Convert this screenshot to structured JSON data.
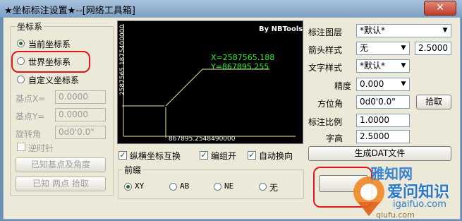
{
  "window": {
    "title": "★坐标标注设置★--[网络工具箱]",
    "close_glyph": "✕"
  },
  "coord_system": {
    "group_label": "坐标系",
    "options": [
      "当前坐标系",
      "世界坐标系",
      "自定义坐标系"
    ],
    "selected": 0,
    "base_x_label": "基点X=",
    "base_x_value": "0.0000",
    "base_y_label": "基点Y=",
    "base_y_value": "0.0000",
    "rotation_label": "旋转角",
    "rotation_value": "0d0'0.0\"",
    "ccw_label": "逆时针",
    "btn_known_base": "已知基点及角度",
    "btn_known_two_points": "已知 两点 拾取"
  },
  "preview": {
    "brand": "By NBTools",
    "x_text": "X=2587565.188",
    "y_text": "Y=867895.255",
    "vertical_axis_text": "2587565.1875400000",
    "horizontal_axis_text": "867895.2548490000",
    "accent_green": "#33ee33",
    "line_color": "#e8e8a0"
  },
  "options_row": {
    "swap_label": "纵横坐标互换",
    "swap_checked": true,
    "group_label": "编组开",
    "group_checked": true,
    "wrap_label": "自动换向",
    "wrap_checked": true
  },
  "prefix": {
    "group_label": "前缀",
    "options": [
      "XY",
      "AB",
      "NE",
      "无"
    ],
    "selected": 0
  },
  "settings": {
    "layer_label": "标注图层",
    "layer_value": "*默认*",
    "arrow_label": "箭头样式",
    "arrow_value": "无",
    "arrow_size": "2.5000",
    "text_style_label": "文字样式",
    "text_style_value": "*默认*",
    "precision_label": "精度",
    "precision_value": "0.000",
    "azimuth_label": "方位角",
    "azimuth_value": "0d0'0.0\"",
    "pick_label": "拾取",
    "scale_label": "标注比例",
    "scale_value": "1.0000",
    "height_label": "字高",
    "height_value": "2.5000",
    "gen_dat_label": "生成DAT文件"
  },
  "watermark": {
    "top_text": "雅知网",
    "brand": "爱问知识",
    "url": "igaifuo.com",
    "bottom_text": "qiufu.com"
  }
}
